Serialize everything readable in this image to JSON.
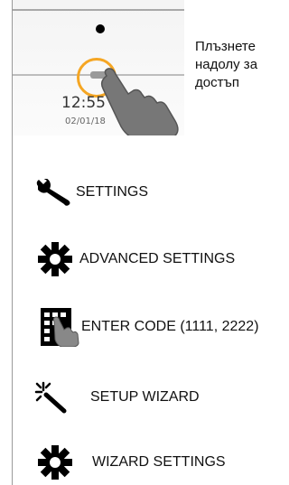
{
  "device_screen": {
    "time": "12:55",
    "date": "02/01/18"
  },
  "instruction_text": "Плъзнете надолу за достъп",
  "menu": [
    {
      "label": "SETTINGS",
      "icon": "wrench-icon"
    },
    {
      "label": "ADVANCED SETTINGS",
      "icon": "gear-icon"
    },
    {
      "label": "ENTER CODE (1111, 2222)",
      "icon": "keypad-touch-icon"
    },
    {
      "label": "SETUP WIZARD",
      "icon": "magic-wand-icon"
    },
    {
      "label": "WIZARD SETTINGS",
      "icon": "gear-icon"
    }
  ],
  "colors": {
    "accent_ring": "#f5a623",
    "icon": "#000000",
    "text": "#111111"
  }
}
